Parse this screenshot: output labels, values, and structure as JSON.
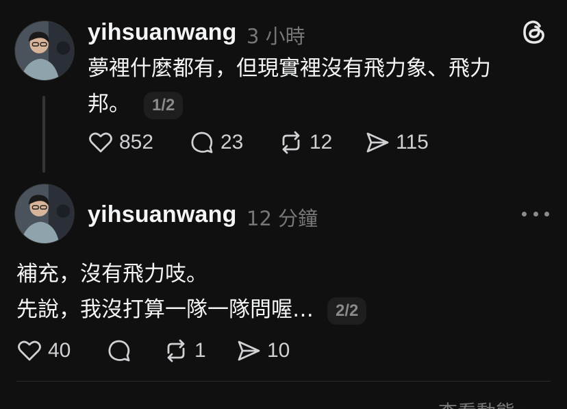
{
  "posts": [
    {
      "username": "yihsuanwang",
      "time": "3 小時",
      "text_line1": "夢裡什麼都有，但現實裡沒有飛力象、飛力",
      "text_line2": "邦。",
      "pager": "1/2",
      "likes": "852",
      "replies": "23",
      "reposts": "12",
      "shares": "115"
    },
    {
      "username": "yihsuanwang",
      "time": "12 分鐘",
      "text_line1": "補充，沒有飛力吱。",
      "text_line2": "先說，我沒打算一隊一隊問喔…",
      "pager": "2/2",
      "likes": "40",
      "replies": "",
      "reposts": "1",
      "shares": "10"
    }
  ],
  "footer": {
    "see_activity": "查看動態 ›"
  },
  "icons": {
    "app_logo": "threads-logo-icon",
    "more": "more-horizontal-icon",
    "like": "heart-icon",
    "reply": "comment-icon",
    "repost": "repost-icon",
    "share": "send-icon"
  },
  "colors": {
    "background": "#101010",
    "text": "#f3f5f7",
    "muted": "#777777",
    "pill": "#1e1e1e"
  }
}
